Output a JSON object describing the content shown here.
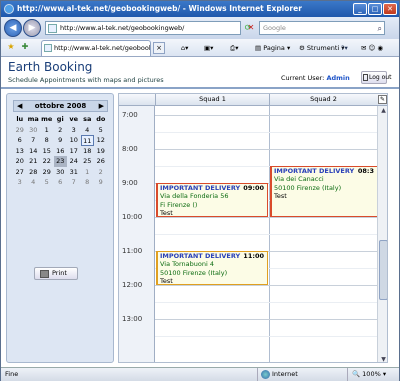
{
  "browser": {
    "title": "http://www.al-tek.net/geobookingweb/ - Windows Internet Explorer",
    "address": "http://www.al-tek.net/geobookingweb/",
    "search_placeholder": "Google",
    "tab_title": "http://www.al-tek.net/geobookingweb/",
    "menu_page": "Pagina",
    "menu_tools": "Strumenti",
    "status_text": "Fine",
    "zone": "Internet",
    "zoom": "100%"
  },
  "app": {
    "title": "Earth Booking",
    "subtitle": "Schedule Appointments with maps and pictures",
    "current_user_label": "Current User:",
    "user": "Admin",
    "logout_label": "Log out",
    "print_label": "Print"
  },
  "calendar": {
    "month_label": "ottobre 2008",
    "weekdays": [
      "lu",
      "ma",
      "me",
      "gi",
      "ve",
      "sa",
      "do"
    ],
    "weeks": [
      [
        "29",
        "30",
        "1",
        "2",
        "3",
        "4",
        "5"
      ],
      [
        "6",
        "7",
        "8",
        "9",
        "10",
        "11",
        "12"
      ],
      [
        "13",
        "14",
        "15",
        "16",
        "17",
        "18",
        "19"
      ],
      [
        "20",
        "21",
        "22",
        "23",
        "24",
        "25",
        "26"
      ],
      [
        "27",
        "28",
        "29",
        "30",
        "31",
        "1",
        "2"
      ],
      [
        "3",
        "4",
        "5",
        "6",
        "7",
        "8",
        "9"
      ]
    ],
    "selected_day": "11",
    "today_day": "23"
  },
  "schedule": {
    "columns": [
      "Squad 1",
      "Squad 2"
    ],
    "hours": [
      "7:00",
      "8:00",
      "9:00",
      "10:00",
      "11:00",
      "12:00",
      "13:00"
    ],
    "appointments": [
      {
        "column": 0,
        "name": "IMPORTANT DELIVERY",
        "time": "09:00",
        "address": "Via della Fonderia 56",
        "city": "Fi   Firenze ()",
        "note": "Test",
        "border": "#d94b2b",
        "start": 9.0,
        "end": 10.0
      },
      {
        "column": 1,
        "name": "IMPORTANT DELIVERY",
        "time": "08:3",
        "address": "Via dei Canacci",
        "city": "50100  Firenze (Italy)",
        "note": "Test",
        "border": "#d94b2b",
        "start": 8.5,
        "end": 10.0
      },
      {
        "column": 0,
        "name": "IMPORTANT DELIVERY",
        "time": "11:00",
        "address": "Via Tornabuoni 4",
        "city": "50100  Firenze (Italy)",
        "note": "Test",
        "border": "#e0a020",
        "start": 11.0,
        "end": 12.0
      }
    ]
  }
}
